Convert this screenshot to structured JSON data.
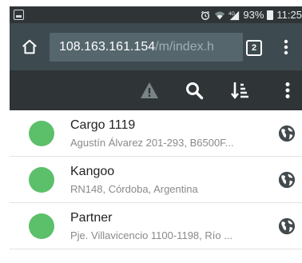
{
  "status_bar": {
    "signal_label": "4G",
    "battery_percent": "93%",
    "time": "11:25",
    "icons": [
      "notification-icon",
      "alarm-icon",
      "wifi-icon",
      "signal-icon",
      "battery-icon"
    ]
  },
  "browser": {
    "url_host": "108.163.161.154",
    "url_path": "/m/index.h",
    "tab_count": "2",
    "icons": [
      "home-icon",
      "tabs-icon",
      "overflow-menu-icon"
    ]
  },
  "toolbar": {
    "icons": [
      "warning-icon",
      "search-icon",
      "sort-icon",
      "overflow-menu-icon"
    ]
  },
  "vehicles": [
    {
      "name": "Cargo 1119",
      "address": "Agustín Álvarez 201-293, B6500F...",
      "status_color": "#5cbf6a"
    },
    {
      "name": "Kangoo",
      "address": "RN148, Córdoba, Argentina",
      "status_color": "#5cbf6a"
    },
    {
      "name": "Partner",
      "address": "Pje. Villavicencio 1100-1198, Río ...",
      "status_color": "#5cbf6a"
    }
  ],
  "colors": {
    "status_bar_bg": "#2f3537",
    "url_bar_bg": "#3d4a50",
    "url_field_bg": "#55666d",
    "app_bar_bg": "#2f3537",
    "status_green": "#5cbf6a"
  }
}
